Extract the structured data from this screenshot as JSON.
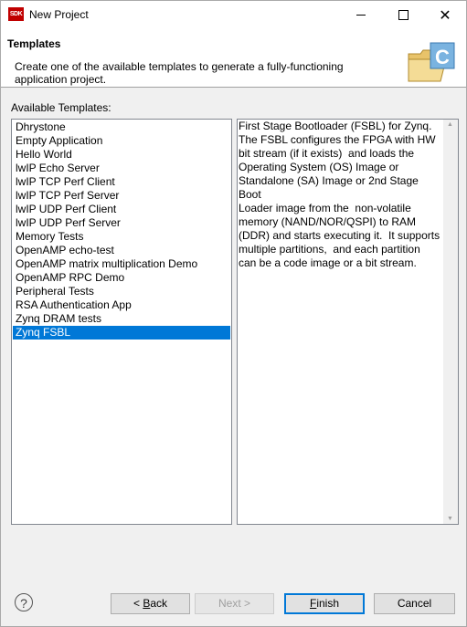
{
  "window": {
    "title": "New Project",
    "app_icon_text": "SDK",
    "minimize_icon": "minimize-icon",
    "maximize_icon": "maximize-icon",
    "close_icon": "close-icon"
  },
  "header": {
    "title": "Templates",
    "description": "Create one of the available templates to generate a fully-functioning application project."
  },
  "templates": {
    "label": "Available Templates:",
    "items": [
      "Dhrystone",
      "Empty Application",
      "Hello World",
      "lwIP Echo Server",
      "lwIP TCP Perf Client",
      "lwIP TCP Perf Server",
      "lwIP UDP Perf Client",
      "lwIP UDP Perf Server",
      "Memory Tests",
      "OpenAMP echo-test",
      "OpenAMP matrix multiplication Demo",
      "OpenAMP RPC Demo",
      "Peripheral Tests",
      "RSA Authentication App",
      "Zynq DRAM tests",
      "Zynq FSBL"
    ],
    "selected": "Zynq FSBL",
    "description": "First Stage Bootloader (FSBL) for Zynq.\nThe FSBL configures the FPGA with HW\nbit stream (if it exists)  and loads the\nOperating System (OS) Image or\nStandalone (SA) Image or 2nd Stage Boot\nLoader image from the  non-volatile\nmemory (NAND/NOR/QSPI) to RAM\n(DDR) and starts executing it.  It supports\nmultiple partitions,  and each partition\ncan be a code image or a bit stream."
  },
  "buttons": {
    "help": "?",
    "back_prefix": "< ",
    "back_mnemonic": "B",
    "back_rest": "ack",
    "next": "Next >",
    "finish_mnemonic": "F",
    "finish_rest": "inish",
    "cancel": "Cancel"
  },
  "colors": {
    "selection": "#0078d7",
    "dialog_bg": "#f0f0f0"
  }
}
